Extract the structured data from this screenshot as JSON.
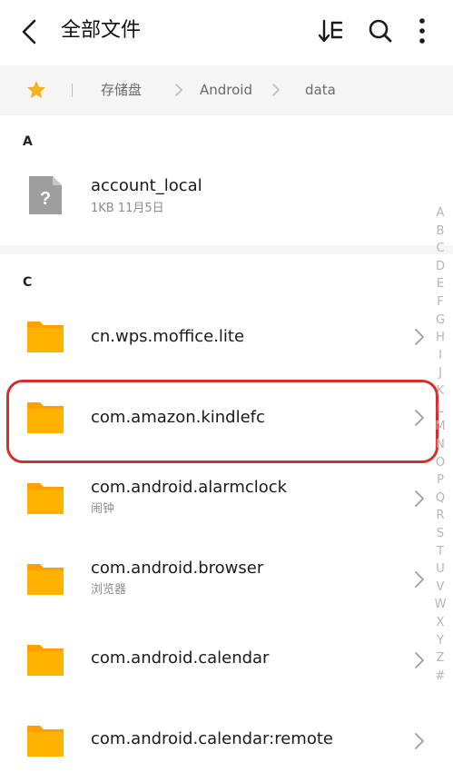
{
  "header": {
    "title": "全部文件",
    "icons": {
      "back": "chevron-left-icon",
      "sort": "sort-icon",
      "search": "search-icon",
      "more": "more-vertical-icon"
    }
  },
  "breadcrumb": {
    "items": [
      "存储盘",
      "Android",
      "data"
    ],
    "accent": "#f6b31a"
  },
  "sections": [
    {
      "letter": "A"
    },
    {
      "letter": "C"
    }
  ],
  "files": [
    {
      "name": "account_local",
      "meta": "1KB  11月5日",
      "type": "unknown-file"
    }
  ],
  "folders": [
    {
      "name": "cn.wps.moffice.lite",
      "sub": ""
    },
    {
      "name": "com.amazon.kindlefc",
      "sub": "",
      "highlighted": true
    },
    {
      "name": "com.android.alarmclock",
      "sub": "闹钟"
    },
    {
      "name": "com.android.browser",
      "sub": "浏览器"
    },
    {
      "name": "com.android.calendar",
      "sub": ""
    },
    {
      "name": "com.android.calendar:remote",
      "sub": ""
    }
  ],
  "alpha_index": [
    "A",
    "B",
    "C",
    "D",
    "E",
    "F",
    "G",
    "H",
    "I",
    "J",
    "K",
    "L",
    "M",
    "N",
    "O",
    "P",
    "Q",
    "R",
    "S",
    "T",
    "U",
    "V",
    "W",
    "X",
    "Y",
    "Z",
    "#"
  ],
  "colors": {
    "folder": "#ffb300",
    "folder_tab": "#ffa000",
    "highlight": "#d32f2f"
  }
}
